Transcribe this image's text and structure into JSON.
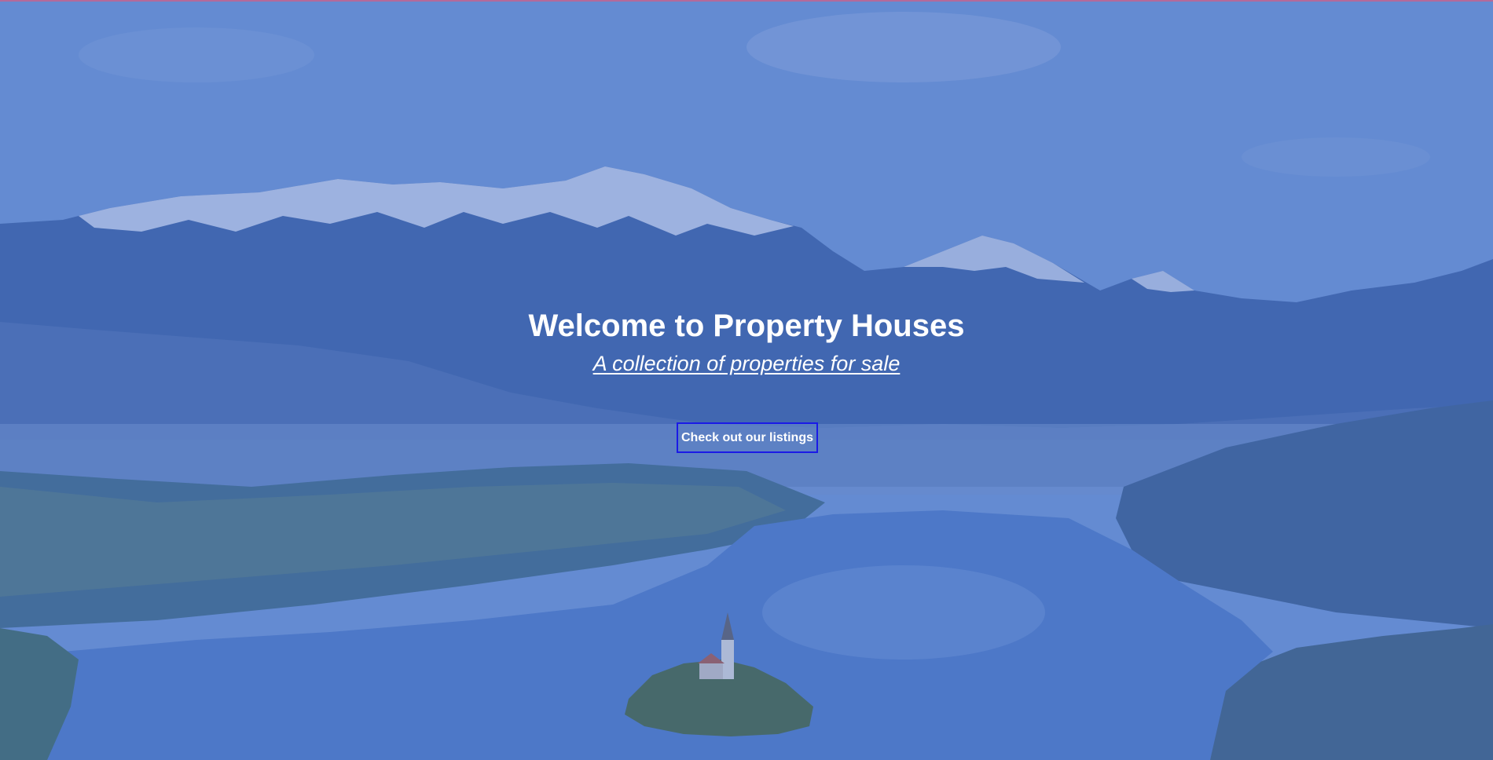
{
  "hero": {
    "title": "Welcome to Property Houses",
    "subtitle": "A collection of properties for sale",
    "cta_label": "Check out our listings",
    "background_description_icon": "mountain-lake-landscape-image"
  },
  "colors": {
    "overlay": "#5b7fc6",
    "text": "#ffffff",
    "button_border": "#1a1ae6",
    "top_accent_line": "#b46a9a"
  }
}
